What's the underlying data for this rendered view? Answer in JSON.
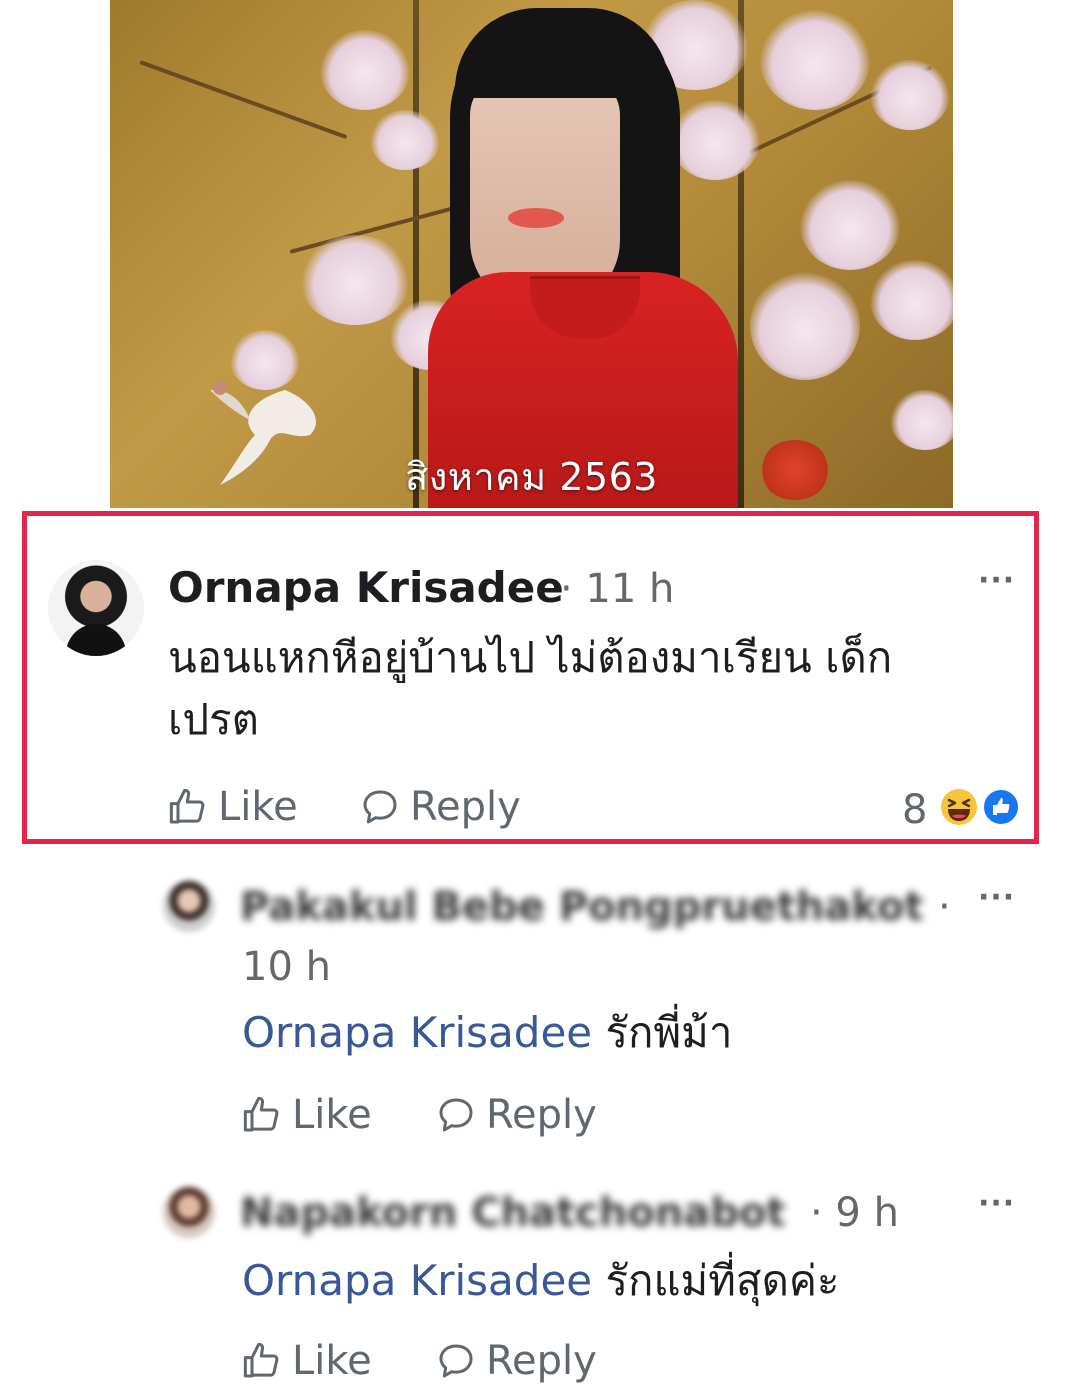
{
  "photo": {
    "caption": "สิงหาคม 2563"
  },
  "main_comment": {
    "author": "Ornapa Krisadee",
    "time": "· 11 h",
    "text_line1": "นอนแหกหีอยู่บ้านไป ไม่ต้องมาเรียน เด็ก",
    "text_line2": "เปรต",
    "like_label": "Like",
    "reply_label": "Reply",
    "reaction_count": "8",
    "more_label": "···"
  },
  "replies": [
    {
      "author": "Pakakul Bebe Pongpruethakot",
      "time_sep": "·",
      "time": "10 h",
      "mention": "Ornapa Krisadee",
      "text": "รักพี่ม้า",
      "like_label": "Like",
      "reply_label": "Reply",
      "more_label": "···"
    },
    {
      "author": "Napakorn Chatchonabot",
      "time": "· 9 h",
      "mention": "Ornapa Krisadee",
      "text": "รักแม่ที่สุดค่ะ",
      "like_label": "Like",
      "reply_label": "Reply",
      "more_label": "···"
    }
  ],
  "colors": {
    "highlight_border": "#e3254a",
    "mention": "#385898",
    "secondary_text": "#606770"
  },
  "icons": [
    "like-thumb-icon",
    "reply-bubble-icon",
    "haha-reaction-icon",
    "like-reaction-icon",
    "more-options-icon"
  ]
}
